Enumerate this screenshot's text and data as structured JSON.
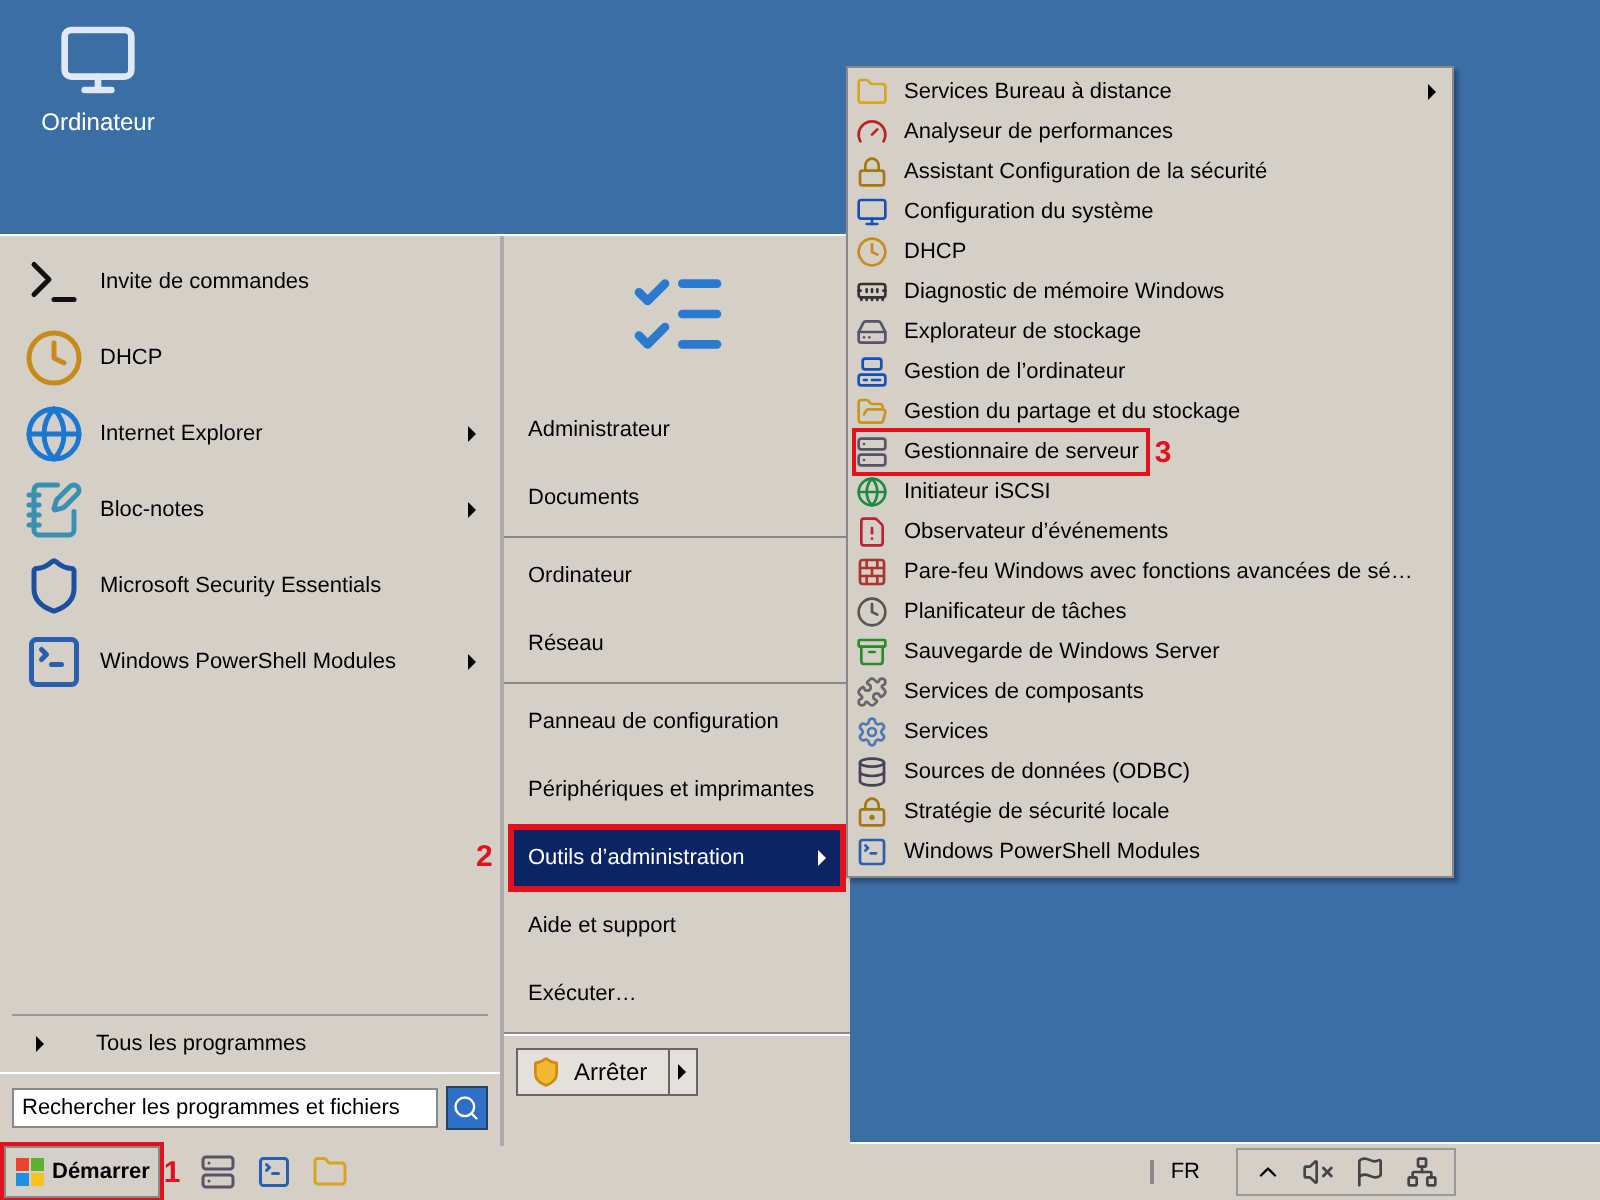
{
  "desktop_icons": [
    {
      "label": "Ordinateur"
    }
  ],
  "start_menu": {
    "programs": [
      {
        "label": "Invite de commandes",
        "has_submenu": false
      },
      {
        "label": "DHCP",
        "has_submenu": false
      },
      {
        "label": "Internet Explorer",
        "has_submenu": true
      },
      {
        "label": "Bloc-notes",
        "has_submenu": true
      },
      {
        "label": "Microsoft Security Essentials",
        "has_submenu": false
      },
      {
        "label": "Windows PowerShell Modules",
        "has_submenu": true
      }
    ],
    "all_programs": "Tous les programmes",
    "search": {
      "placeholder": "Rechercher les programmes et fichiers"
    },
    "places": [
      [
        {
          "label": "Administrateur",
          "selected": false,
          "has_submenu": false
        },
        {
          "label": "Documents",
          "selected": false,
          "has_submenu": false
        }
      ],
      [
        {
          "label": "Ordinateur",
          "selected": false,
          "has_submenu": false
        },
        {
          "label": "Réseau",
          "selected": false,
          "has_submenu": false
        }
      ],
      [
        {
          "label": "Panneau de configuration",
          "selected": false,
          "has_submenu": false
        },
        {
          "label": "Périphériques et imprimantes",
          "selected": false,
          "has_submenu": false
        },
        {
          "label": "Outils d’administration",
          "selected": true,
          "has_submenu": true,
          "annotation": "2"
        },
        {
          "label": "Aide et support",
          "selected": false,
          "has_submenu": false
        },
        {
          "label": "Exécuter…",
          "selected": false,
          "has_submenu": false
        }
      ]
    ],
    "shutdown": "Arrêter"
  },
  "submenu": {
    "items": [
      {
        "label": "Services Bureau à distance",
        "has_submenu": true
      },
      {
        "label": "Analyseur de performances",
        "has_submenu": false
      },
      {
        "label": "Assistant Configuration de la sécurité",
        "has_submenu": false
      },
      {
        "label": "Configuration du système",
        "has_submenu": false
      },
      {
        "label": "DHCP",
        "has_submenu": false
      },
      {
        "label": "Diagnostic de mémoire Windows",
        "has_submenu": false
      },
      {
        "label": "Explorateur de stockage",
        "has_submenu": false
      },
      {
        "label": "Gestion de l’ordinateur",
        "has_submenu": false
      },
      {
        "label": "Gestion du partage et du stockage",
        "has_submenu": false
      },
      {
        "label": "Gestionnaire de serveur",
        "has_submenu": false,
        "annotation": "3"
      },
      {
        "label": "Initiateur iSCSI",
        "has_submenu": false
      },
      {
        "label": "Observateur d’événements",
        "has_submenu": false
      },
      {
        "label": "Pare-feu Windows avec fonctions avancées de sé…",
        "has_submenu": false
      },
      {
        "label": "Planificateur de tâches",
        "has_submenu": false
      },
      {
        "label": "Sauvegarde de Windows Server",
        "has_submenu": false
      },
      {
        "label": "Services de composants",
        "has_submenu": false
      },
      {
        "label": "Services",
        "has_submenu": false
      },
      {
        "label": "Sources de données (ODBC)",
        "has_submenu": false
      },
      {
        "label": "Stratégie de sécurité locale",
        "has_submenu": false
      },
      {
        "label": "Windows PowerShell Modules",
        "has_submenu": false
      }
    ]
  },
  "taskbar": {
    "start": "Démarrer",
    "start_annotation": "1",
    "language": "FR"
  }
}
